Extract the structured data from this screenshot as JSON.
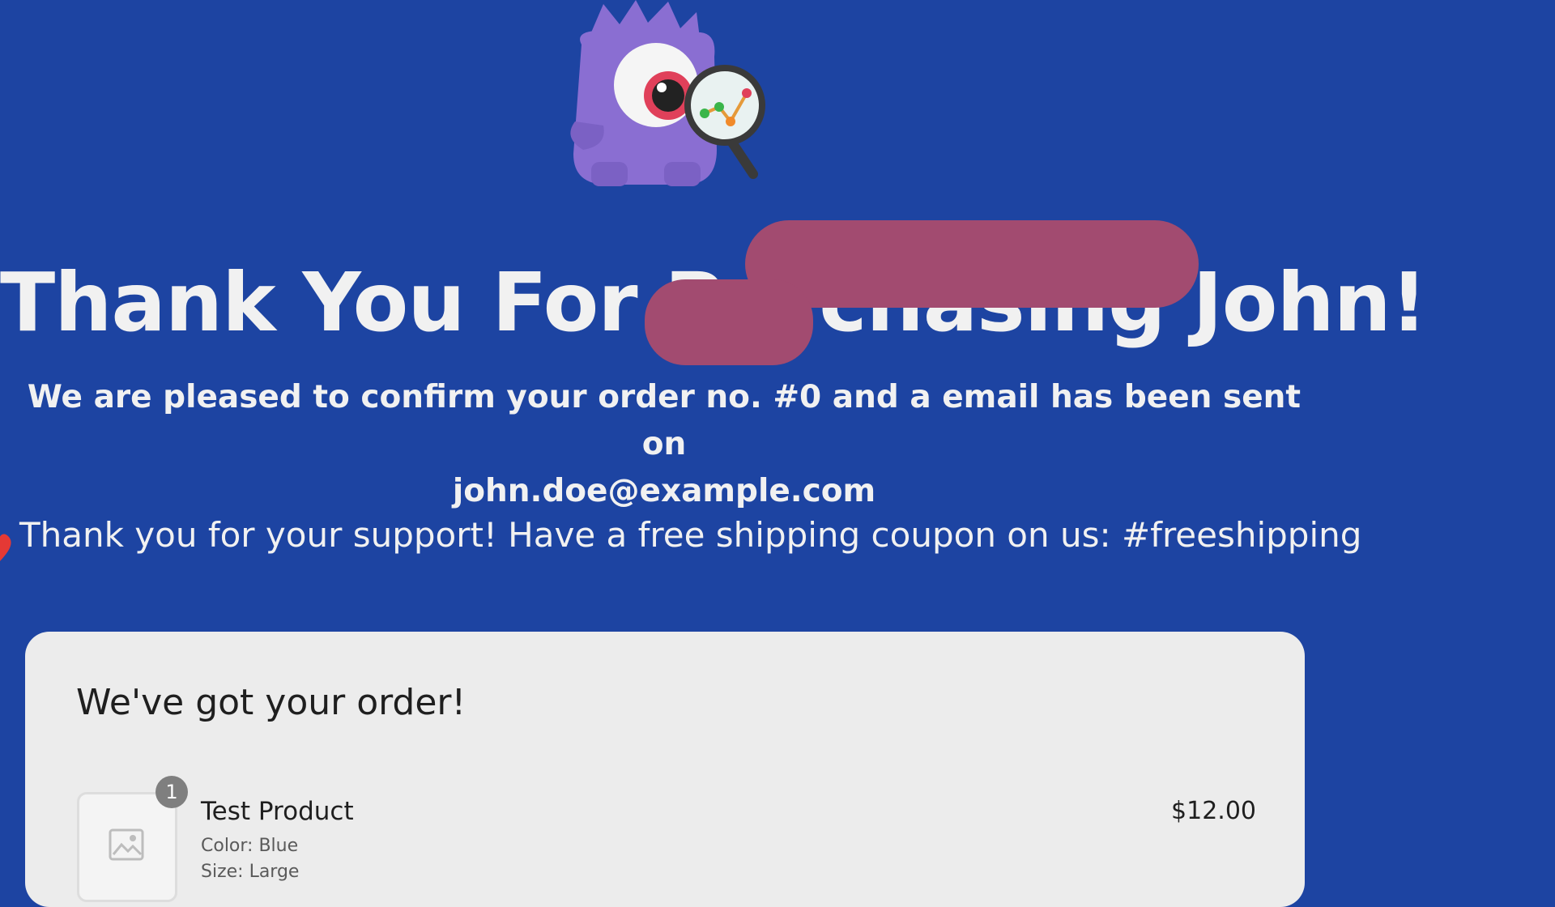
{
  "mascot": {
    "icon": "monster-mascot-with-magnifier"
  },
  "headline": "Thank You For Purchasing John!",
  "confirmation": {
    "line1": "We are pleased to confirm your order no. #0 and a email has been sent on",
    "email": "john.doe@example.com"
  },
  "promo": "Thank you for your support! Have a free shipping coupon on us: #freeshipping",
  "order": {
    "title": "We've got your order!",
    "items": [
      {
        "quantity": "1",
        "name": "Test Product",
        "color": "Color: Blue",
        "size": "Size: Large",
        "price": "$12.00"
      }
    ]
  },
  "colors": {
    "background": "#1d44a2",
    "redaction": "#a24b70",
    "card": "#ececec",
    "heart": "#e53935"
  }
}
